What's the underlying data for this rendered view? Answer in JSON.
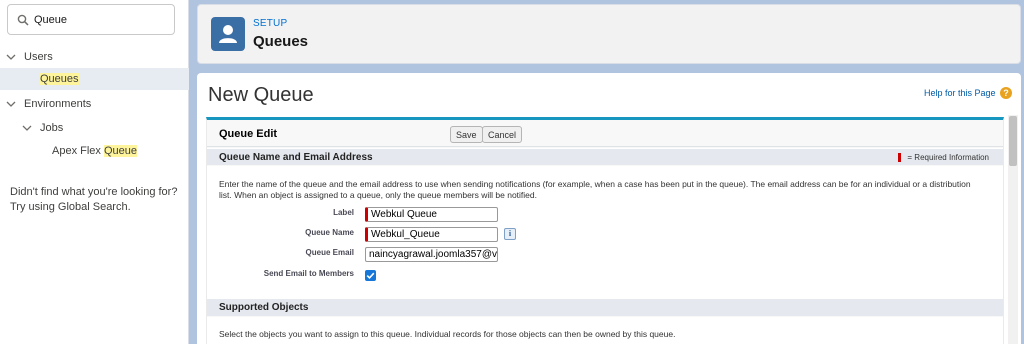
{
  "sidebar": {
    "search_value": "Queue",
    "tree": [
      {
        "label": "Users",
        "expanded": true
      },
      {
        "label_pre": "",
        "label_hl": "Queue",
        "label_post": "s",
        "active": true
      },
      {
        "label": "Environments",
        "expanded": true
      },
      {
        "label": "Jobs",
        "expanded": true
      },
      {
        "label_pre": "Apex Flex ",
        "label_hl": "Queue",
        "label_post": ""
      }
    ],
    "tip_line1": "Didn't find what you're looking for?",
    "tip_line2": "Try using Global Search."
  },
  "header": {
    "eyebrow": "SETUP",
    "title": "Queues",
    "icon": "user-icon"
  },
  "main": {
    "page_title": "New Queue",
    "help_link": "Help for this Page",
    "block_title": "Queue Edit",
    "save_label": "Save",
    "cancel_label": "Cancel",
    "section1_title": "Queue Name and Email Address",
    "required_info": "= Required Information",
    "section1_desc_1": "Enter the name of the queue and the email address to use when sending notifications (for example, when a case has been put in the queue). The email address can be for an individual or a distribution",
    "section1_desc_2": "list. When an object is assigned to a queue, only the queue members will be notified.",
    "label_label": "Label",
    "label_value": "Webkul Queue",
    "queue_name_label": "Queue Name",
    "queue_name_value": "Webkul_Queue",
    "queue_email_label": "Queue Email",
    "queue_email_value": "naincyagrawal.joomla357@v",
    "send_email_label": "Send Email to Members",
    "send_email_checked": true,
    "section2_title": "Supported Objects",
    "section2_desc": "Select the objects you want to assign to this queue. Individual records for those objects can then be owned by this queue."
  },
  "colors": {
    "accent": "#0070d2",
    "header_tile": "#3a6fa5",
    "required": "#cc0000",
    "highlight": "#fef49c"
  }
}
